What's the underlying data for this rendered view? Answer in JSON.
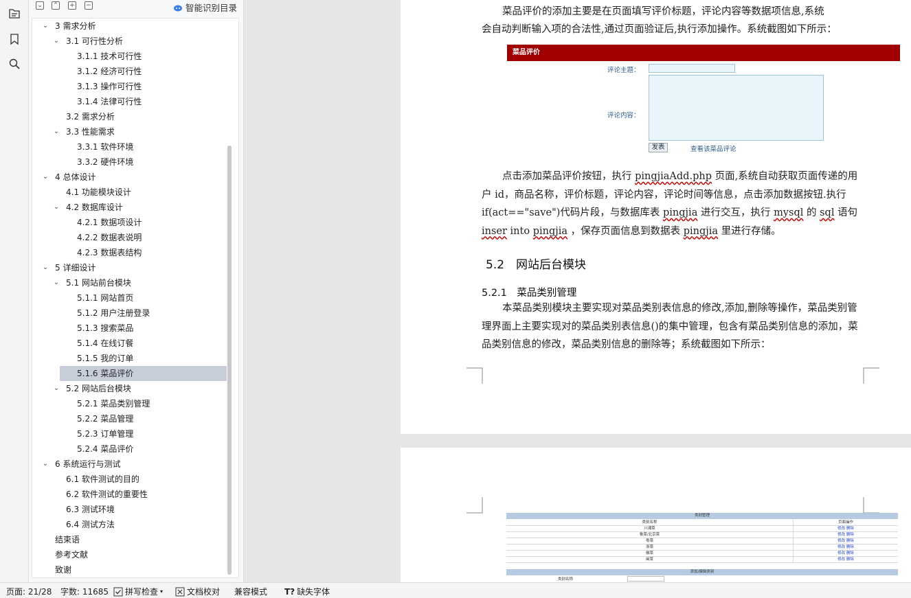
{
  "toc_panel": {
    "toolbar_icons": [
      "collapse-all-icon",
      "expand-all-icon",
      "add-icon",
      "remove-icon"
    ],
    "smart_toc_label": "智能识别目录",
    "items": [
      {
        "text": "3  需求分析",
        "level": 1,
        "expanded": true
      },
      {
        "text": "3.1  可行性分析",
        "level": 2,
        "expanded": true
      },
      {
        "text": "3.1.1  技术可行性",
        "level": 3
      },
      {
        "text": "3.1.2  经济可行性",
        "level": 3
      },
      {
        "text": "3.1.3  操作可行性",
        "level": 3
      },
      {
        "text": "3.1.4  法律可行性",
        "level": 3
      },
      {
        "text": "3.2  需求分析",
        "level": 2
      },
      {
        "text": "3.3  性能需求",
        "level": 2,
        "expanded": true
      },
      {
        "text": "3.3.1  软件环境",
        "level": 3
      },
      {
        "text": "3.3.2  硬件环境",
        "level": 3
      },
      {
        "text": "4  总体设计",
        "level": 1,
        "expanded": true
      },
      {
        "text": "4.1  功能模块设计",
        "level": 2
      },
      {
        "text": "4.2  数据库设计",
        "level": 2,
        "expanded": true
      },
      {
        "text": "4.2.1  数据项设计",
        "level": 3
      },
      {
        "text": "4.2.2  数据表说明",
        "level": 3
      },
      {
        "text": "4.2.3  数据表结构",
        "level": 3
      },
      {
        "text": "5  详细设计",
        "level": 1,
        "expanded": true
      },
      {
        "text": "5.1  网站前台模块",
        "level": 2,
        "expanded": true
      },
      {
        "text": "5.1.1  网站首页",
        "level": 3
      },
      {
        "text": "5.1.2  用户注册登录",
        "level": 3
      },
      {
        "text": "5.1.3  搜索菜品",
        "level": 3
      },
      {
        "text": "5.1.4  在线订餐",
        "level": 3
      },
      {
        "text": "5.1.5  我的订单",
        "level": 3
      },
      {
        "text": "5.1.6  菜品评价",
        "level": 3,
        "selected": true
      },
      {
        "text": "5.2  网站后台模块",
        "level": 2,
        "expanded": true
      },
      {
        "text": "5.2.1  菜品类别管理",
        "level": 3
      },
      {
        "text": "5.2.2  菜品管理",
        "level": 3
      },
      {
        "text": "5.2.3  订单管理",
        "level": 3
      },
      {
        "text": "5.2.4  菜品评价",
        "level": 3
      },
      {
        "text": "6  系统运行与测试",
        "level": 1,
        "expanded": true
      },
      {
        "text": "6.1  软件测试的目的",
        "level": 2
      },
      {
        "text": "6.2  软件测试的重要性",
        "level": 2
      },
      {
        "text": "6.3  测试环境",
        "level": 2
      },
      {
        "text": "6.4  测试方法",
        "level": 2
      },
      {
        "text": "结束语",
        "level": 1
      },
      {
        "text": "参考文献",
        "level": 1
      },
      {
        "text": "致谢",
        "level": 1
      }
    ]
  },
  "document": {
    "para1_line1": "菜品评价的添加主要是在页面填写评价标题，评论内容等数据项信息,系统",
    "para1_line2": "会自动判断输入项的合法性,通过页面验证后,执行添加操作。系统截图如下所示：",
    "form_screenshot": {
      "bar_title": "菜品评价",
      "topic_label": "评论主题：",
      "content_label": "评论内容：",
      "submit_label": "发表",
      "view_link": "查看该菜品评论"
    },
    "para2": [
      {
        "t": "点击添加菜品评价按钮，执行 "
      },
      {
        "t": "pingjiaAdd.php",
        "wavy": true
      },
      {
        "t": " 页面,系统自动获取页面传递的用户 id，商品名称，评价标题，评论内容，评论时间等信息，点击添加数据按钮.执行  if(act==\"save\")代码片段，与数据库表 "
      },
      {
        "t": "pingjia",
        "wavy": true
      },
      {
        "t": " 进行交互，执行 "
      },
      {
        "t": "mysql",
        "wavy": true
      },
      {
        "t": " 的 "
      },
      {
        "t": "sql",
        "wavy": true
      },
      {
        "t": " 语句 "
      },
      {
        "t": "inser",
        "wavy": true
      },
      {
        "t": " into "
      },
      {
        "t": "pingjia",
        "wavy": true
      },
      {
        "t": "  ，保存页面信息到数据表 "
      },
      {
        "t": "pingjia",
        "wavy": true
      },
      {
        "t": " 里进行存储。"
      }
    ],
    "heading_52": "5.2　网站后台模块",
    "heading_521": "5.2.1　菜品类别管理",
    "para3": "本菜品类别模块主要实现对菜品类别表信息的修改,添加,删除等操作，菜品类别管理界面上主要实现对的菜品类别表信息()的集中管理，包含有菜品类别信息的添加，菜品类别信息的修改，菜品类别信息的删除等；系统截图如下所示：",
    "table_screenshot": {
      "title": "类别管理",
      "col1": "类别名称",
      "col2": "页面操作",
      "rows": [
        "川湘菜",
        "鲁菜/北京菜",
        "粤菜",
        "浙菜",
        "徽菜",
        "闽菜"
      ],
      "action": "修改 删除",
      "footer_title": "添加/编辑类别",
      "footer_label": "类别名称"
    }
  },
  "status_bar": {
    "page": "页面: 21/28",
    "words": "字数: 11685",
    "spell": "拼写检查",
    "proof": "文档校对",
    "compat": "兼容模式",
    "missing_font": "缺失字体"
  }
}
